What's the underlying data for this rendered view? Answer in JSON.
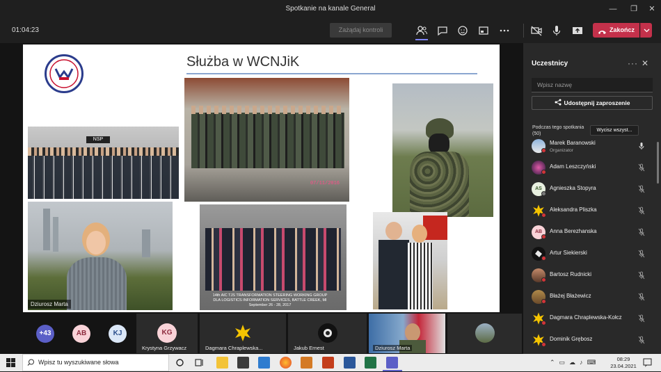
{
  "window": {
    "title": "Spotkanie na kanale General"
  },
  "toolbar": {
    "timer": "01:04:23",
    "request_control": "Zażądaj kontroli",
    "end_button": "Zakończ"
  },
  "slide": {
    "title": "Służba w WCNJiK",
    "photo_date": "07/11/2016",
    "photo_caption": "14th AIC TJS TRANSFORMATION STEERING WORKING GROUP DLA LOGISTICS INFORMATION SERVICES, BATTLE CREEK, MI September 26 - 28, 2017",
    "sign_text": "NSP"
  },
  "stage": {
    "speaker_name": "Dziurosz Marta"
  },
  "gallery": {
    "overflow_count": "+43",
    "avatars": [
      "AB",
      "KJ"
    ],
    "tiles": [
      {
        "initials": "KG",
        "name": "Krystyna Grzywacz"
      },
      {
        "name": "Dagmara Chraplewska..."
      },
      {
        "name": "Jakub Ernest"
      },
      {
        "name": "Dziurosz Marta"
      },
      {
        "name": ""
      }
    ]
  },
  "panel": {
    "title": "Uczestnicy",
    "search_placeholder": "Wpisz nazwę",
    "invite": "Udostępnij zaproszenie",
    "section": "Podczas tego spotkania (50)",
    "mute_all": "Wycisz wszyst...",
    "participants": [
      {
        "name": "Marek Baranowski",
        "role": "Organizator"
      },
      {
        "name": "Adam Leszczyński"
      },
      {
        "name": "Agnieszka Stopyra",
        "initials": "AS"
      },
      {
        "name": "Aleksandra Pliszka"
      },
      {
        "name": "Anna Berezhanska",
        "initials": "AB"
      },
      {
        "name": "Artur Siekierski"
      },
      {
        "name": "Bartosz Rudnicki"
      },
      {
        "name": "Błażej Błażewicz"
      },
      {
        "name": "Dagmara Chraplewska-Kołcz"
      },
      {
        "name": "Dominik Grębosz"
      }
    ]
  },
  "taskbar": {
    "search_placeholder": "Wpisz tu wyszukiwane słowa",
    "time": "08:29",
    "date": "23.04.2021"
  },
  "colors": {
    "accent": "#7f85f5",
    "end_call": "#c4314b",
    "panel_bg": "#292929"
  }
}
